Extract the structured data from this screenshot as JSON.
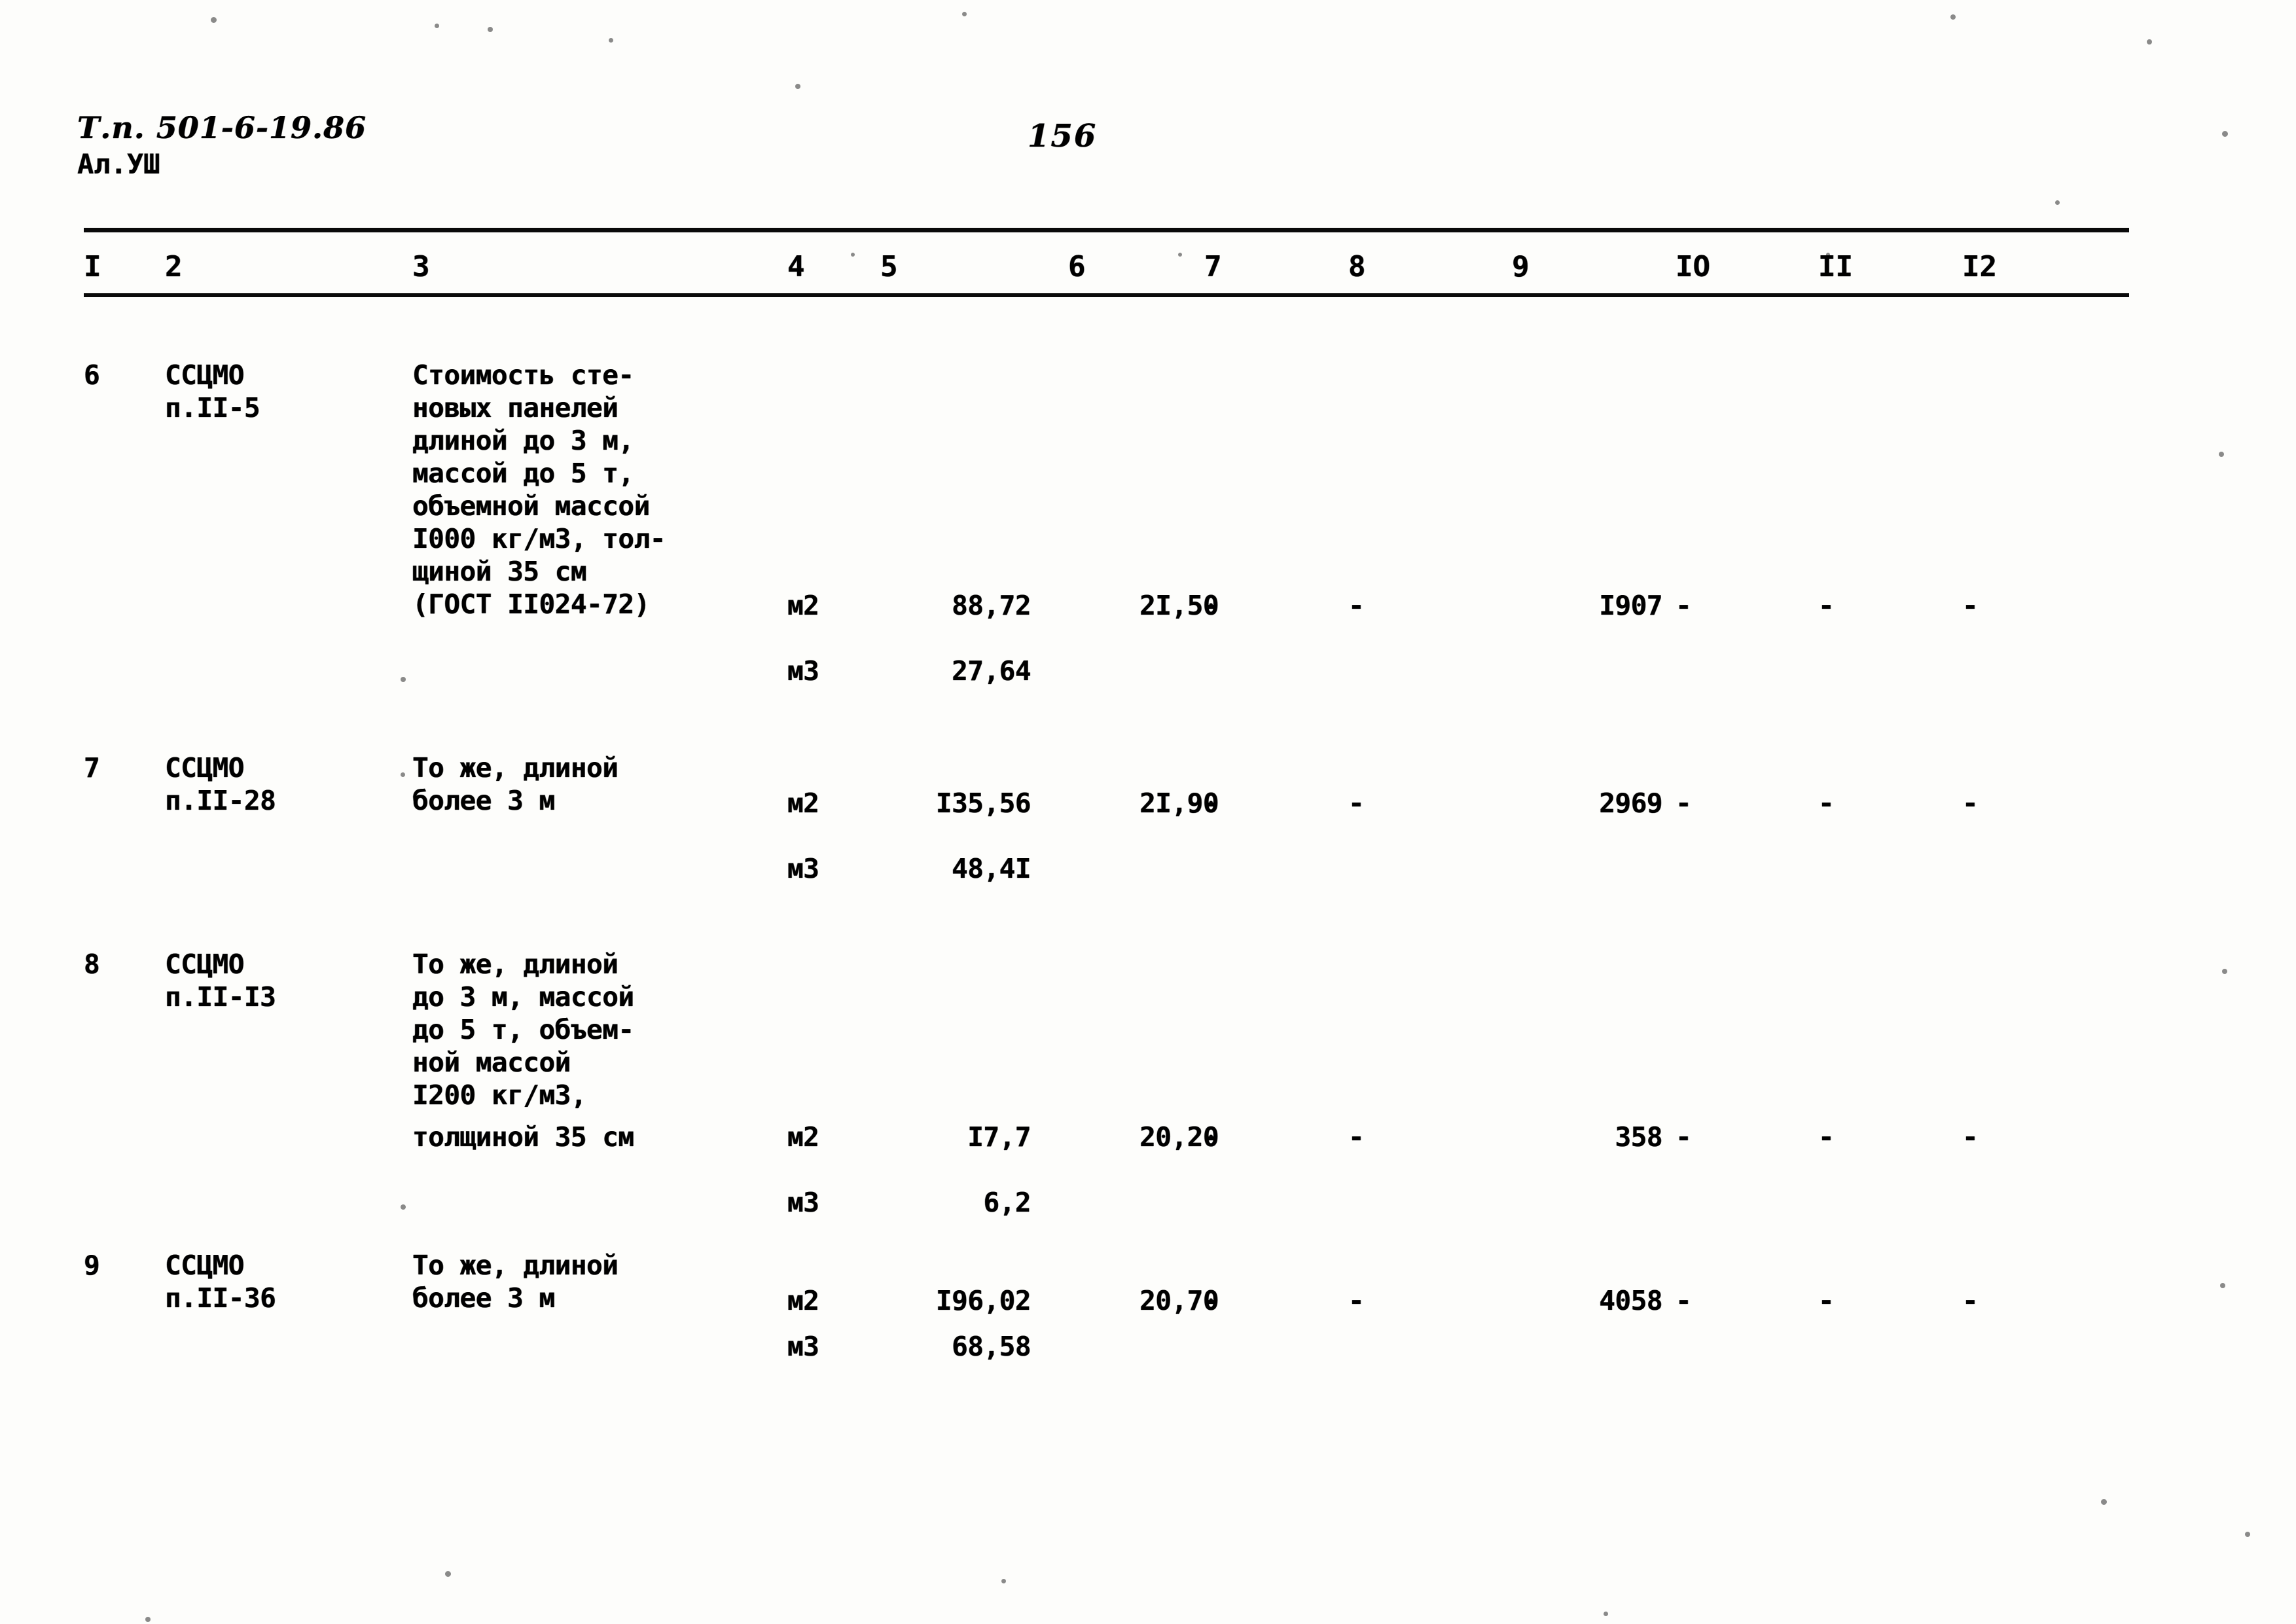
{
  "header": {
    "project_code": "Т.п. 501-6-19.86",
    "album": "Ал.УШ",
    "page_number": "156"
  },
  "table": {
    "column_headers": [
      "I",
      "2",
      "3",
      "4",
      "5",
      "6",
      "7",
      "8",
      "9",
      "IO",
      "II",
      "I2"
    ],
    "dash": "-",
    "rows": [
      {
        "num": "6",
        "code_line1": "ССЦМО",
        "code_line2": "п.II-5",
        "description_lines": [
          "Стоимость сте-",
          "новых панелей",
          "длиной до 3 м,",
          "массой до 5 т,",
          "объемной массой",
          "I000 кг/м3, тол-",
          "щиной 35 см",
          "(ГОСТ II024-72)"
        ],
        "measures": [
          {
            "unit": "м2",
            "qty": "88,72",
            "price": "2I,50",
            "col6": "-",
            "col7": "-",
            "total": "I907",
            "col9": "-",
            "col10": "-",
            "col11": "-"
          },
          {
            "unit": "м3",
            "qty": "27,64",
            "price": "",
            "col6": "",
            "col7": "",
            "total": "",
            "col9": "",
            "col10": "",
            "col11": ""
          }
        ]
      },
      {
        "num": "7",
        "code_line1": "ССЦМО",
        "code_line2": "п.II-28",
        "description_lines": [
          "То же, длиной",
          "более 3 м"
        ],
        "measures": [
          {
            "unit": "м2",
            "qty": "I35,56",
            "price": "2I,90",
            "col6": "-",
            "col7": "-",
            "total": "2969",
            "col9": "-",
            "col10": "-",
            "col11": "-"
          },
          {
            "unit": "м3",
            "qty": "48,4I",
            "price": "",
            "col6": "",
            "col7": "",
            "total": "",
            "col9": "",
            "col10": "",
            "col11": ""
          }
        ]
      },
      {
        "num": "8",
        "code_line1": "ССЦМО",
        "code_line2": "п.II-I3",
        "description_lines": [
          "То же, длиной",
          "до 3 м, массой",
          "до 5 т, объем-",
          "ной массой",
          "I200 кг/м3,",
          "толщиной 35 см"
        ],
        "measures": [
          {
            "unit": "м2",
            "qty": "I7,7",
            "price": "20,20",
            "col6": "-",
            "col7": "-",
            "total": "358",
            "col9": "-",
            "col10": "-",
            "col11": "-"
          },
          {
            "unit": "м3",
            "qty": "6,2",
            "price": "",
            "col6": "",
            "col7": "",
            "total": "",
            "col9": "",
            "col10": "",
            "col11": ""
          }
        ]
      },
      {
        "num": "9",
        "code_line1": "ССЦМО",
        "code_line2": "п.II-36",
        "description_lines": [
          "То же, длиной",
          "более 3 м"
        ],
        "measures": [
          {
            "unit": "м2",
            "qty": "I96,02",
            "price": "20,70",
            "col6": "-",
            "col7": "-",
            "total": "4058",
            "col9": "-",
            "col10": "-",
            "col11": "-"
          },
          {
            "unit": "м3",
            "qty": "68,58",
            "price": "",
            "col6": "",
            "col7": "",
            "total": "",
            "col9": "",
            "col10": "",
            "col11": ""
          }
        ]
      }
    ]
  }
}
